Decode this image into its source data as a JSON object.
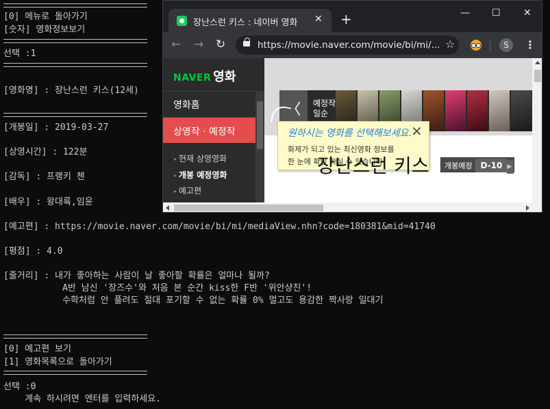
{
  "terminal": {
    "lines": {
      "back_menu": "[0] 메뉴로 돌아가기",
      "view_info": "[숫자] 영화정보보기",
      "choice1": "선택 :1",
      "title": "[영화명] : 장난스런 키스(12세)",
      "release": "[개봉일] : 2019-03-27",
      "runtime": "[상영시간] : 122분",
      "director": "[감독] : 프랭키 첸",
      "actors": "[배우] : 왕대륙,임윤",
      "trailer": "[예고편] : https://movie.naver.com/movie/bi/mi/mediaView.nhn?code=180381&mid=41740",
      "rating": "[평점] : 4.0",
      "plot1": "[줄거리] : 내가 좋아하는 사람이 날 좋아할 확률은 얼마나 될까?",
      "plot2": "           A반 남신 '장즈수'와 처음 본 순간 kiss한 F반 '위안샹친'!",
      "plot3": "           수학처럼 안 풀려도 절대 포기할 수 없는 확률 0% 멀고도 용감한 짝사랑 일대기",
      "opt_trailer": "[0] 예고편 보기",
      "opt_list": "[1] 영화목록으로 돌아가기",
      "choice0": "선택 :0",
      "continue": "    계속 하시려면 엔터를 입력하세요."
    }
  },
  "browser": {
    "tab_title": "장난스런 키스 : 네이버 영화",
    "tab_close": "✕",
    "new_tab": "+",
    "minimize": "—",
    "maximize": "☐",
    "close": "✕",
    "back": "←",
    "forward": "→",
    "reload": "↻",
    "url": "https://movie.naver.com/movie/bi/mi/...",
    "star": "☆",
    "avatar_letter": "S",
    "menu": "⋮"
  },
  "page": {
    "logo_naver": "NAVER",
    "logo_movie": "영화",
    "sidebar": {
      "home": "영화홈",
      "section": "상영작 · 예정작",
      "items": [
        "현재 상영영화",
        "개봉 예정영화",
        "예고편"
      ]
    },
    "banner": {
      "title": "예정작 개봉일순",
      "prev_label": "〈"
    },
    "tooltip": {
      "heading": "원하시는 영화를 선택해보세요.",
      "line1": "화제가 되고 있는 최신영화 정보를",
      "line2": "한 눈에 확인 하실 수 있습니다.",
      "close": "✕"
    },
    "movie_title": "장난스런 키스",
    "badge_label": "개봉예정",
    "badge_dday": "D-10",
    "badge_arrow": "▶"
  },
  "colors": {
    "terminal_bg": "#0c0c0c",
    "terminal_fg": "#cccccc",
    "naver_green": "#00c73c",
    "sidebar_active": "#e54d4d",
    "tooltip_blue": "#1f7fd1"
  }
}
